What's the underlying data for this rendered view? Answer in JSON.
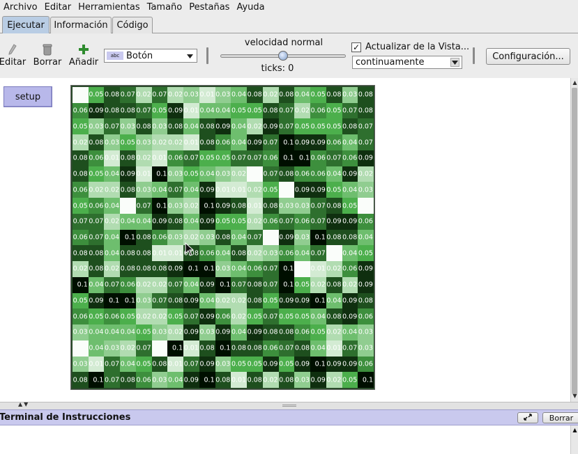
{
  "menubar": [
    "Archivo",
    "Editar",
    "Herramientas",
    "Tamaño",
    "Pestañas",
    "Ayuda"
  ],
  "tabs": {
    "run": "Ejecutar",
    "info": "Información",
    "code": "Código"
  },
  "toolbar": {
    "edit": "Editar",
    "delete": "Borrar",
    "add": "Añadir",
    "widget_type": "Botón",
    "speed_label": "velocidad normal",
    "speed_position": 0.5,
    "ticks": "ticks: 0",
    "update_label": "Actualizar de la Vista...",
    "update_checked": true,
    "update_mode": "continuamente",
    "settings": "Configuración..."
  },
  "widgets": {
    "setup": "setup"
  },
  "world": {
    "rows": [
      [
        "",
        "0.05",
        "0.08",
        "0.07",
        "0.02",
        "0.07",
        "0.02",
        "0.03",
        "0.01",
        "0.03",
        "0.04",
        "0.08",
        "0.02",
        "0.08",
        "0.04",
        "0.05",
        "0.08",
        "0.03",
        "0.08"
      ],
      [
        "0.06",
        "0.09",
        "0.08",
        "0.08",
        "0.07",
        "0.05",
        "0.09",
        "0.01",
        "0.04",
        "0.04",
        "0.05",
        "0.05",
        "0.08",
        "0.07",
        "0.02",
        "0.06",
        "0.05",
        "0.07",
        "0.08"
      ],
      [
        "0.05",
        "0.03",
        "0.07",
        "0.03",
        "0.08",
        "0.03",
        "0.08",
        "0.04",
        "0.08",
        "0.09",
        "0.04",
        "0.02",
        "0.09",
        "0.07",
        "0.05",
        "0.05",
        "0.05",
        "0.08",
        "0.07"
      ],
      [
        "0.02",
        "0.08",
        "0.03",
        "0.05",
        "0.03",
        "0.02",
        "0.02",
        "0.01",
        "0.08",
        "0.06",
        "0.04",
        "0.09",
        "0.07",
        "0.1",
        "0.09",
        "0.09",
        "0.06",
        "0.04",
        "0.07"
      ],
      [
        "0.08",
        "0.06",
        "0.01",
        "0.08",
        "0.02",
        "0.01",
        "0.06",
        "0.07",
        "0.05",
        "0.05",
        "0.07",
        "0.07",
        "0.06",
        "0.1",
        "0.1",
        "0.06",
        "0.07",
        "0.06",
        "0.09"
      ],
      [
        "0.08",
        "0.05",
        "0.04",
        "0.09",
        "0.01",
        "0.1",
        "0.03",
        "0.05",
        "0.04",
        "0.03",
        "0.02",
        "",
        "0.07",
        "0.08",
        "0.06",
        "0.06",
        "0.04",
        "0.09",
        "0.02"
      ],
      [
        "0.06",
        "0.02",
        "0.02",
        "0.08",
        "0.03",
        "0.04",
        "0.07",
        "0.04",
        "0.09",
        "0.01",
        "0.01",
        "0.02",
        "0.05",
        "",
        "0.09",
        "0.09",
        "0.05",
        "0.04",
        "0.03"
      ],
      [
        "0.05",
        "0.06",
        "0.04",
        "",
        "0.07",
        "0.1",
        "0.03",
        "0.02",
        "0.1",
        "0.09",
        "0.08",
        "0.01",
        "0.08",
        "0.03",
        "0.03",
        "0.07",
        "0.08",
        "0.05",
        ""
      ],
      [
        "0.07",
        "0.07",
        "0.02",
        "0.04",
        "0.04",
        "0.09",
        "0.08",
        "0.04",
        "0.09",
        "0.05",
        "0.05",
        "0.02",
        "0.06",
        "0.07",
        "0.06",
        "0.07",
        "0.09",
        "0.09",
        "0.06"
      ],
      [
        "0.06",
        "0.07",
        "0.04",
        "0.1",
        "0.08",
        "0.06",
        "0.03",
        "0.02",
        "0.03",
        "0.08",
        "0.04",
        "0.07",
        "",
        "0.09",
        "0.03",
        "0.1",
        "0.08",
        "0.08",
        "0.04"
      ],
      [
        "0.08",
        "0.08",
        "0.04",
        "0.08",
        "0.08",
        "0.01",
        "0.01",
        "0.08",
        "0.06",
        "0.04",
        "0.08",
        "0.02",
        "0.03",
        "0.06",
        "0.04",
        "0.07",
        "",
        "0.04",
        "0.05"
      ],
      [
        "0.02",
        "0.08",
        "0.02",
        "0.08",
        "0.08",
        "0.08",
        "0.09",
        "0.1",
        "0.1",
        "0.03",
        "0.04",
        "0.06",
        "0.07",
        "0.1",
        "",
        "0.01",
        "0.02",
        "0.06",
        "0.09"
      ],
      [
        "0.1",
        "0.04",
        "0.07",
        "0.06",
        "0.02",
        "0.02",
        "0.07",
        "0.04",
        "0.09",
        "0.1",
        "0.07",
        "0.08",
        "0.07",
        "0.1",
        "0.05",
        "0.02",
        "0.08",
        "0.02",
        "0.09"
      ],
      [
        "0.05",
        "0.09",
        "0.1",
        "0.1",
        "0.03",
        "0.07",
        "0.08",
        "0.09",
        "0.04",
        "0.02",
        "0.02",
        "0.08",
        "0.05",
        "0.09",
        "0.09",
        "0.1",
        "0.04",
        "0.09",
        "0.08"
      ],
      [
        "0.06",
        "0.05",
        "0.06",
        "0.05",
        "0.02",
        "0.02",
        "0.05",
        "0.07",
        "0.09",
        "0.06",
        "0.02",
        "0.05",
        "0.07",
        "0.05",
        "0.05",
        "0.04",
        "0.08",
        "0.09",
        "0.06"
      ],
      [
        "0.03",
        "0.04",
        "0.04",
        "0.04",
        "0.05",
        "0.03",
        "0.02",
        "0.09",
        "0.03",
        "0.09",
        "0.04",
        "0.09",
        "0.08",
        "0.08",
        "0.06",
        "0.05",
        "0.02",
        "0.04",
        "0.03"
      ],
      [
        "",
        "0.04",
        "0.03",
        "0.02",
        "0.07",
        "",
        "0.1",
        "0.01",
        "0.08",
        "0.1",
        "0.08",
        "0.08",
        "0.06",
        "0.07",
        "0.08",
        "0.04",
        "0.01",
        "0.07",
        "0.03"
      ],
      [
        "0.03",
        "0.01",
        "0.07",
        "0.04",
        "0.05",
        "0.08",
        "0.01",
        "0.07",
        "0.09",
        "0.03",
        "0.05",
        "0.05",
        "0.09",
        "0.05",
        "0.09",
        "0.1",
        "0.09",
        "0.09",
        "0.06"
      ],
      [
        "0.08",
        "0.1",
        "0.07",
        "0.08",
        "0.06",
        "0.03",
        "0.04",
        "0.09",
        "0.1",
        "0.08",
        "0.01",
        "0.08",
        "0.02",
        "0.08",
        "0.03",
        "0.09",
        "0.02",
        "0.05",
        "0.1"
      ]
    ]
  },
  "terminal": {
    "title": "Terminal de Instrucciones",
    "clear": "Borrar"
  }
}
